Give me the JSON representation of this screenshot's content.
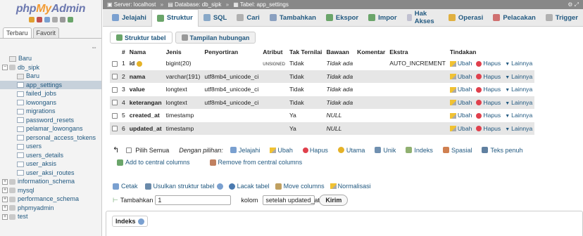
{
  "logo": {
    "php": "php",
    "my": "My",
    "admin": "Admin"
  },
  "nav": {
    "tabs": [
      "Terbaru",
      "Favorit"
    ],
    "collapse": "⇔",
    "tree": [
      {
        "label": "Baru",
        "level": 0,
        "kind": "new"
      },
      {
        "label": "db_sipk",
        "level": 0,
        "kind": "db",
        "expand": "−"
      },
      {
        "label": "Baru",
        "level": 1,
        "kind": "new"
      },
      {
        "label": "app_settings",
        "level": 1,
        "kind": "tbl",
        "selected": true
      },
      {
        "label": "failed_jobs",
        "level": 1,
        "kind": "tbl"
      },
      {
        "label": "lowongans",
        "level": 1,
        "kind": "tbl"
      },
      {
        "label": "migrations",
        "level": 1,
        "kind": "tbl"
      },
      {
        "label": "password_resets",
        "level": 1,
        "kind": "tbl"
      },
      {
        "label": "pelamar_lowongans",
        "level": 1,
        "kind": "tbl"
      },
      {
        "label": "personal_access_tokens",
        "level": 1,
        "kind": "tbl"
      },
      {
        "label": "users",
        "level": 1,
        "kind": "tbl"
      },
      {
        "label": "users_details",
        "level": 1,
        "kind": "tbl"
      },
      {
        "label": "user_aksis",
        "level": 1,
        "kind": "tbl"
      },
      {
        "label": "user_aksi_routes",
        "level": 1,
        "kind": "tbl"
      },
      {
        "label": "information_schema",
        "level": 0,
        "kind": "db",
        "expand": "+"
      },
      {
        "label": "mysql",
        "level": 0,
        "kind": "db",
        "expand": "+"
      },
      {
        "label": "performance_schema",
        "level": 0,
        "kind": "db",
        "expand": "+"
      },
      {
        "label": "phpmyadmin",
        "level": 0,
        "kind": "db",
        "expand": "+"
      },
      {
        "label": "test",
        "level": 0,
        "kind": "db",
        "expand": "+"
      }
    ]
  },
  "breadcrumb": {
    "server": "Server: localhost",
    "database": "Database: db_sipk",
    "table": "Tabel: app_settings",
    "sep": "»"
  },
  "menu": [
    {
      "label": "Jelajahi",
      "color": "#7aa0d0"
    },
    {
      "label": "Struktur",
      "color": "#6aa56a",
      "active": true
    },
    {
      "label": "SQL",
      "color": "#88a8c8"
    },
    {
      "label": "Cari",
      "color": "#b0b0b0"
    },
    {
      "label": "Tambahkan",
      "color": "#8aa0c0"
    },
    {
      "label": "Ekspor",
      "color": "#6aa56a"
    },
    {
      "label": "Impor",
      "color": "#6aa56a"
    },
    {
      "label": "Hak Akses",
      "color": "#c0c0d0"
    },
    {
      "label": "Operasi",
      "color": "#e0b040"
    },
    {
      "label": "Pelacakan",
      "color": "#d07070"
    },
    {
      "label": "Trigger",
      "color": "#b0b0b0"
    }
  ],
  "subtabs": {
    "structure": "Struktur tabel",
    "relations": "Tampilan hubungan"
  },
  "table": {
    "headers": [
      "#",
      "Nama",
      "Jenis",
      "Penyortiran",
      "Atribut",
      "Tak Ternilai",
      "Bawaan",
      "Komentar",
      "Ekstra",
      "Tindakan"
    ],
    "rows": [
      {
        "n": "1",
        "name": "id",
        "type": "bigint(20)",
        "coll": "",
        "attr": "UNSIGNED",
        "null": "Tidak",
        "def": "Tidak ada",
        "comment": "",
        "extra": "AUTO_INCREMENT"
      },
      {
        "n": "2",
        "name": "nama",
        "type": "varchar(191)",
        "coll": "utf8mb4_unicode_ci",
        "attr": "",
        "null": "Tidak",
        "def": "Tidak ada",
        "comment": "",
        "extra": ""
      },
      {
        "n": "3",
        "name": "value",
        "type": "longtext",
        "coll": "utf8mb4_unicode_ci",
        "attr": "",
        "null": "Tidak",
        "def": "Tidak ada",
        "comment": "",
        "extra": ""
      },
      {
        "n": "4",
        "name": "keterangan",
        "type": "longtext",
        "coll": "utf8mb4_unicode_ci",
        "attr": "",
        "null": "Tidak",
        "def": "Tidak ada",
        "comment": "",
        "extra": ""
      },
      {
        "n": "5",
        "name": "created_at",
        "type": "timestamp",
        "coll": "",
        "attr": "",
        "null": "Ya",
        "def": "NULL",
        "comment": "",
        "extra": ""
      },
      {
        "n": "6",
        "name": "updated_at",
        "type": "timestamp",
        "coll": "",
        "attr": "",
        "null": "Ya",
        "def": "NULL",
        "comment": "",
        "extra": ""
      }
    ],
    "actions": {
      "edit": "Ubah",
      "drop": "Hapus",
      "more": "Lainnya"
    }
  },
  "bulk": {
    "check_all": "Pilih Semua",
    "with_selected": "Dengan pilihan:",
    "browse": "Jelajahi",
    "edit": "Ubah",
    "drop": "Hapus",
    "primary": "Utama",
    "unique": "Unik",
    "index": "Indeks",
    "spatial": "Spasial",
    "fulltext": "Teks penuh",
    "add_central": "Add to central columns",
    "remove_central": "Remove from central columns"
  },
  "tools": {
    "print": "Cetak",
    "propose": "Usulkan struktur tabel",
    "track": "Lacak tabel",
    "move": "Move columns",
    "normalize": "Normalisasi"
  },
  "add": {
    "label": "Tambahkan",
    "count": "1",
    "unit": "kolom",
    "position": "setelah updated_at",
    "submit": "Kirim"
  },
  "indexes": {
    "legend": "Indeks"
  }
}
